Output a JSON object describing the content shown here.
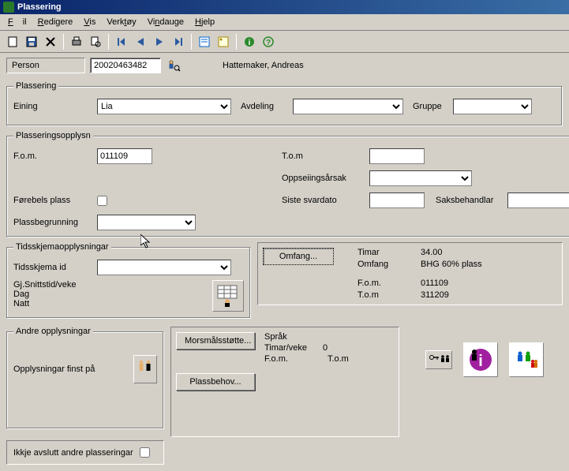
{
  "window": {
    "title": "Plassering"
  },
  "menu": {
    "fil": "Fil",
    "redigere": "Redigere",
    "vis": "Vis",
    "verktoy": "Verktøy",
    "vindauge": "Vindauge",
    "hjelp": "Hjelp"
  },
  "infobar": {
    "person_label": "Person",
    "person_id": "20020463482",
    "person_name": "Hattemaker, Andreas"
  },
  "plassering": {
    "legend": "Plassering",
    "eining_label": "Eining",
    "eining_value": "Lia",
    "avdeling_label": "Avdeling",
    "avdeling_value": "",
    "gruppe_label": "Gruppe",
    "gruppe_value": ""
  },
  "plasseringsopplysn": {
    "legend": "Plasseringsopplysn",
    "fom_label": "F.o.m.",
    "fom_value": "011109",
    "tom_label": "T.o.m",
    "tom_value": "",
    "oppseiing_label": "Oppseiingsårsak",
    "oppseiing_value": "",
    "forebels_label": "Førebels plass",
    "forebels_checked": false,
    "siste_label": "Siste svardato",
    "siste_value": "",
    "saksbehandlar_label": "Saksbehandlar",
    "saksbehandlar_value": "",
    "plassbegrunning_label": "Plassbegrunning",
    "plassbegrunning_value": ""
  },
  "tidsskjema": {
    "legend": "Tidsskjemaopplysningar",
    "id_label": "Tidsskjema id",
    "id_value": "",
    "gjsnitt_label": "Gj.Snittstid/veke",
    "dag_label": "Dag",
    "natt_label": "Natt",
    "omfang_btn": "Omfang...",
    "timar_label": "Timar",
    "timar_value": "34.00",
    "omfang_label": "Omfang",
    "omfang_value": "BHG 60% plass",
    "fom_label": "F.o.m.",
    "fom_value": "011109",
    "tom_label": "T.o.m",
    "tom_value": "311209"
  },
  "andre": {
    "legend": "Andre opplysningar",
    "opplysningar_label": "Opplysningar finst på",
    "morsmaal_btn": "Morsmålsstøtte...",
    "sprak_label": "Språk",
    "timar_veke_label": "Timar/veke",
    "timar_veke_value": "0",
    "fom_label": "F.o.m.",
    "tom_label": "T.o.m",
    "plassbehov_btn": "Plassbehov...",
    "ikkje_avslutt_label": "Ikkje avslutt andre plasseringar",
    "ikkje_avslutt_checked": false
  }
}
